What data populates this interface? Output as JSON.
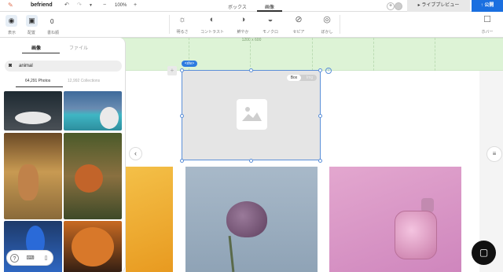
{
  "topbar": {
    "project_name": "befriend",
    "zoom": "100%",
    "tabs": [
      {
        "label": "ボックス"
      },
      {
        "label": "画像"
      }
    ],
    "live_preview": "ライブプレビュー",
    "publish": "公開"
  },
  "toolbar": {
    "display_label": "表示",
    "layout_label": "配置",
    "image_count_label": "書ね順",
    "image_count_value": "0",
    "filters": [
      {
        "label": "明るさ",
        "icon": "sun-icon"
      },
      {
        "label": "コントラスト",
        "icon": "contrast-icon"
      },
      {
        "label": "鮮やか",
        "icon": "vibrance-icon"
      },
      {
        "label": "モノクロ",
        "icon": "mono-icon"
      },
      {
        "label": "セピア",
        "icon": "sepia-icon"
      },
      {
        "label": "ぼかし",
        "icon": "blur-icon"
      }
    ],
    "hover_label": "ホバー"
  },
  "canvas": {
    "band_size_label": "1200 x 600",
    "div_tag": "<div>",
    "bg_toggle": {
      "on": "Box",
      "off": "Img"
    }
  },
  "panel": {
    "tabs": [
      {
        "label": "画像"
      },
      {
        "label": "ファイル"
      }
    ],
    "search_value": "animal",
    "photos_count": "64,291 Photos",
    "collections_count": "12,992 Collections"
  }
}
